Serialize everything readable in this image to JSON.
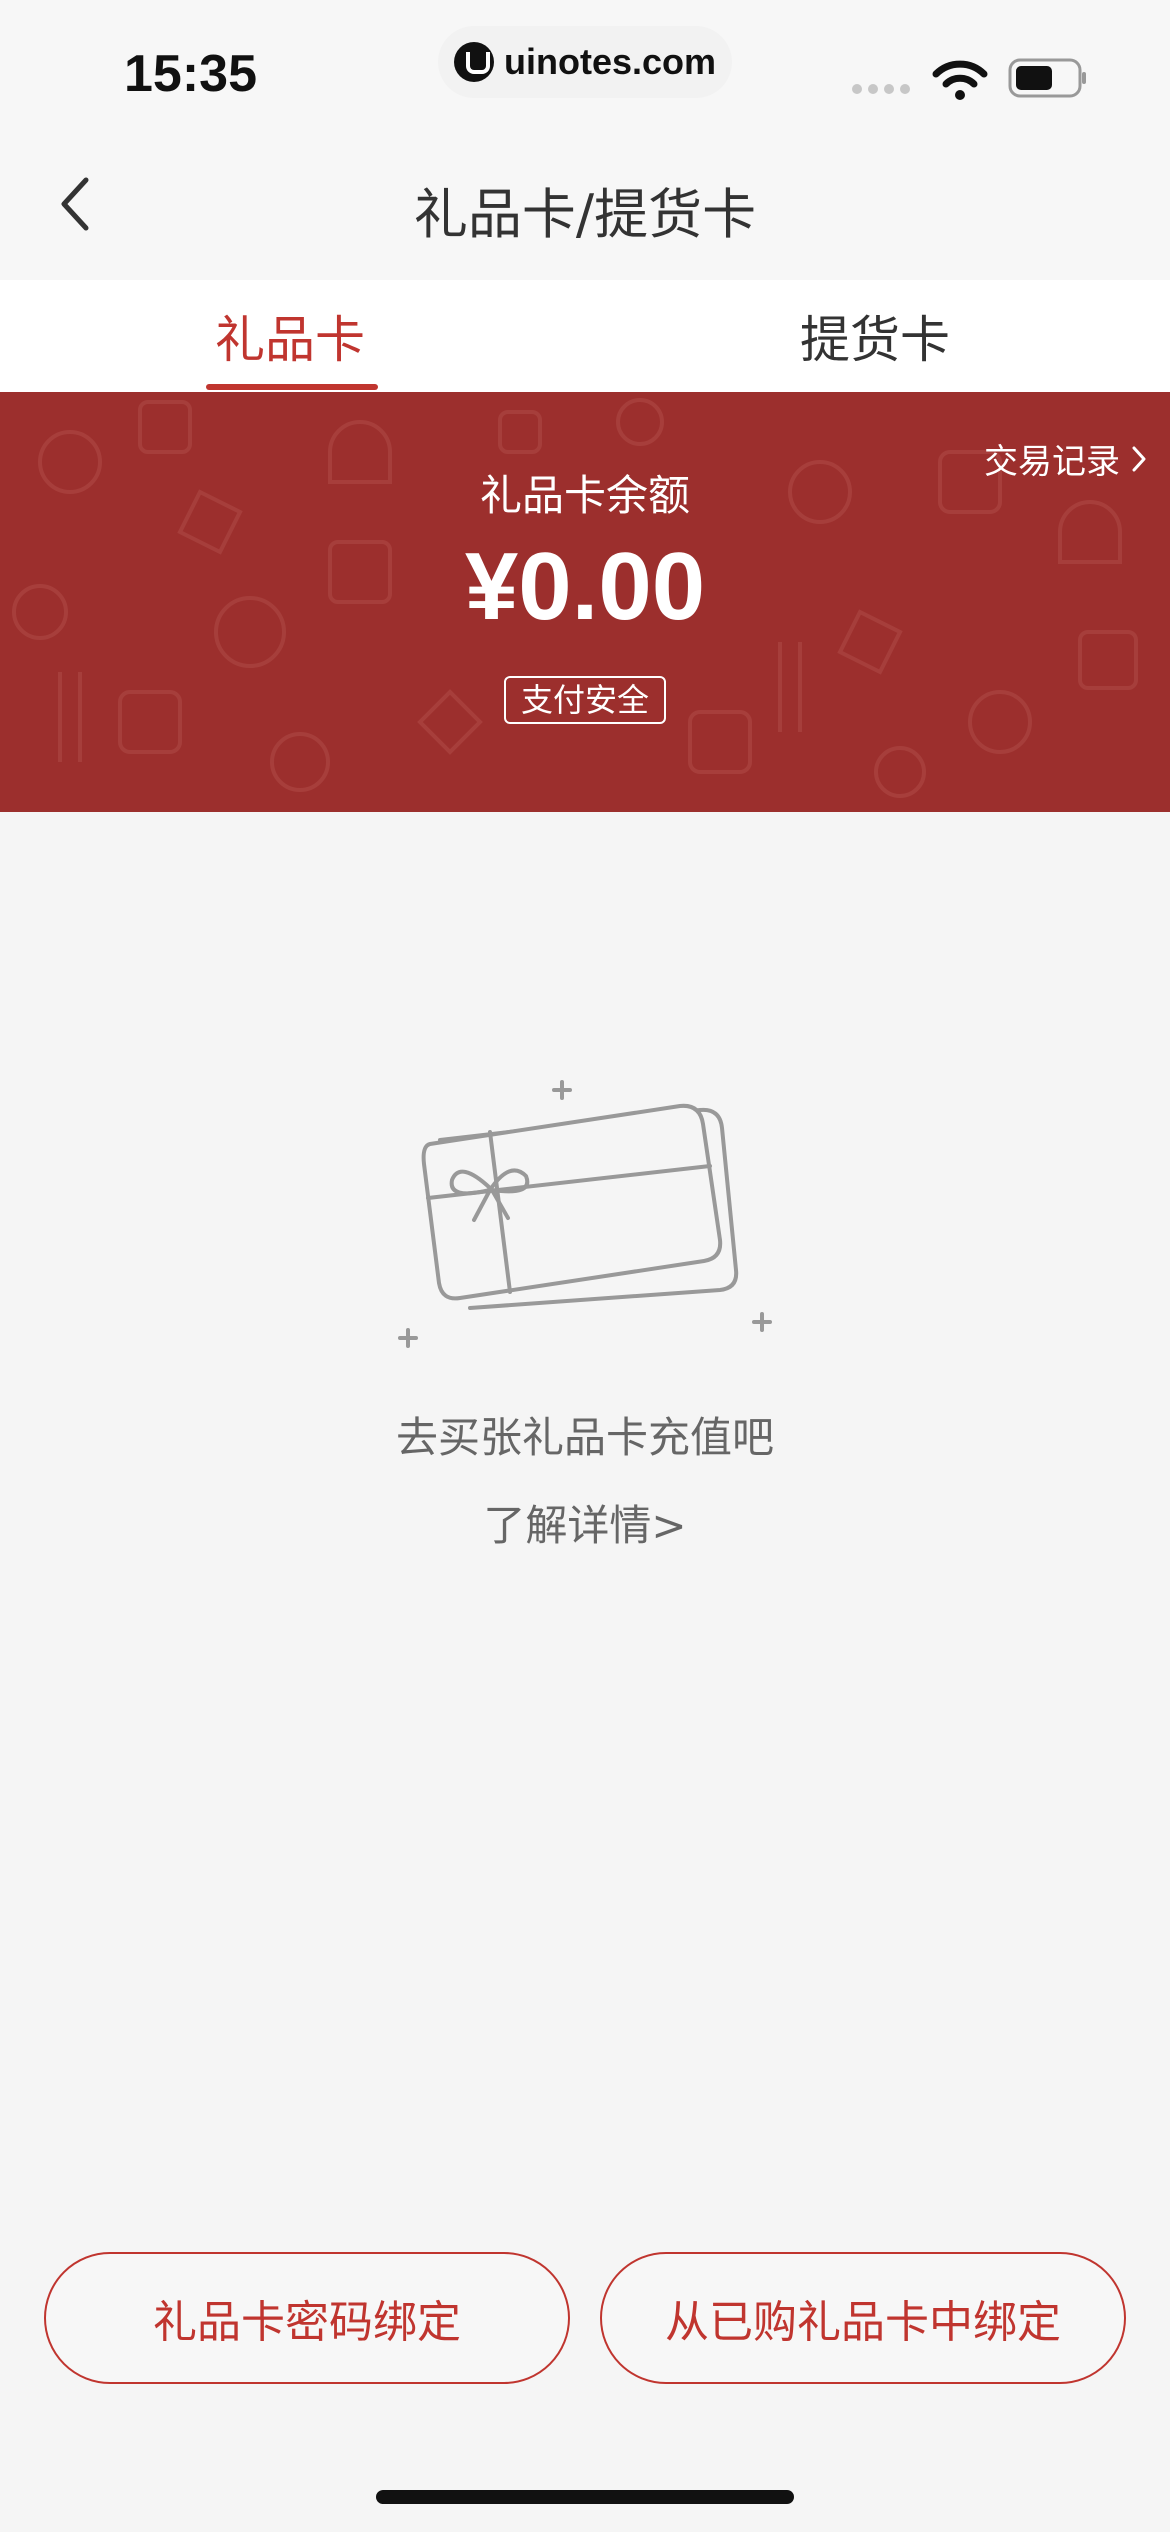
{
  "status_bar": {
    "time": "15:35",
    "url": "uinotes.com"
  },
  "nav": {
    "title": "礼品卡/提货卡",
    "back_icon": "chevron-left-icon"
  },
  "tabs": [
    {
      "label": "礼品卡",
      "active": true
    },
    {
      "label": "提货卡",
      "active": false
    }
  ],
  "banner": {
    "records_label": "交易记录",
    "balance_label": "礼品卡余额",
    "balance_value": "¥0.00",
    "secure_badge": "支付安全",
    "background_color": "#9c2f2d"
  },
  "empty_state": {
    "illustration_icon": "gift-card-icon",
    "message": "去买张礼品卡充值吧",
    "link": "了解详情>"
  },
  "actions": {
    "bind_by_password": "礼品卡密码绑定",
    "bind_from_purchased": "从已购礼品卡中绑定"
  },
  "colors": {
    "accent": "#c0352f"
  }
}
